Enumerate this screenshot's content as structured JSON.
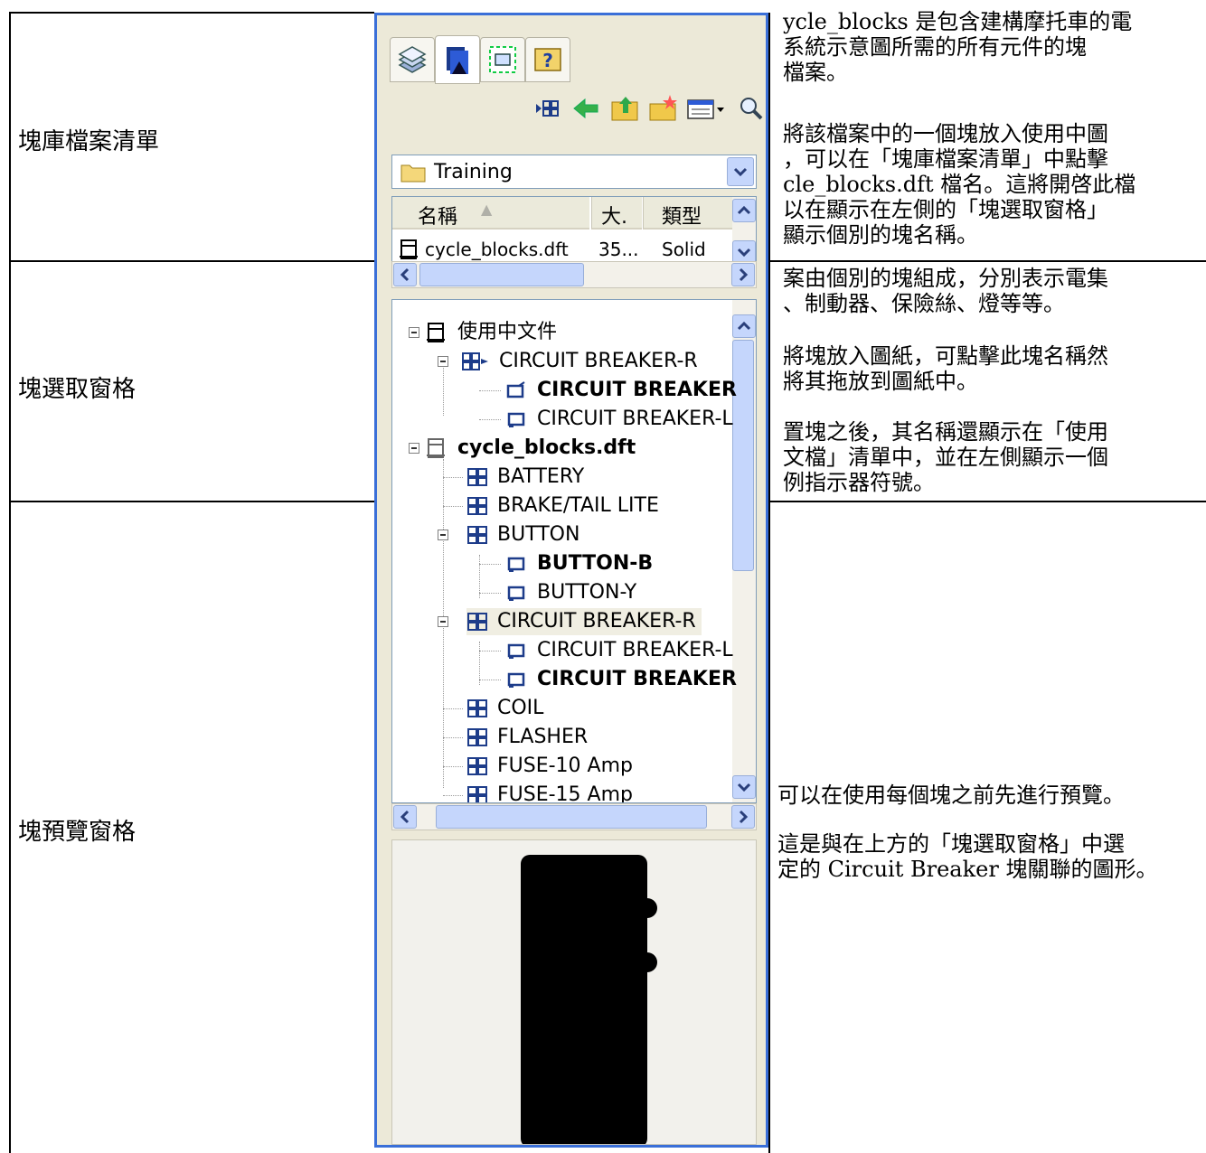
{
  "labels": {
    "library": "塊庫檔案清單",
    "selection": "塊選取窗格",
    "preview": "塊預覽窗格"
  },
  "panel": {
    "tabs": [
      "layers-icon",
      "library-icon",
      "blocks-icon",
      "help-icon"
    ],
    "toolbar": [
      "view-icon",
      "back-icon",
      "up-folder-icon",
      "new-folder-icon",
      "views-menu-icon",
      "search-icon"
    ],
    "folder": "Training",
    "list_headers": {
      "name": "名稱",
      "size": "大.",
      "type": "類型"
    },
    "file_row": {
      "name": "cycle_blocks.dft",
      "size": "35...",
      "type": "Solid Edge"
    },
    "tree": {
      "active_doc": "使用中文件",
      "active_block": "CIRCUIT BREAKER-R",
      "active_children": [
        "CIRCUIT BREAKER",
        "CIRCUIT BREAKER-L"
      ],
      "file": "cycle_blocks.dft",
      "items": [
        "BATTERY",
        "BRAKE/TAIL LITE",
        "BUTTON"
      ],
      "button_children": [
        "BUTTON-B",
        "BUTTON-Y"
      ],
      "cb": "CIRCUIT BREAKER-R",
      "cb_children": [
        "CIRCUIT BREAKER-L",
        "CIRCUIT BREAKER"
      ],
      "more": [
        "COIL",
        "FLASHER",
        "FUSE-10 Amp",
        "FUSE-15 Amp"
      ]
    }
  },
  "right": {
    "p1": [
      "ycle_blocks 是包含建構摩托車的電",
      "系統示意圖所需的所有元件的塊",
      "檔案。"
    ],
    "p2": [
      "將該檔案中的一個塊放入使用中圖",
      "，可以在「塊庫檔案清單」中點擊",
      "cle_blocks.dft 檔名。這將開啓此檔",
      "以在顯示在左側的「塊選取窗格」",
      "顯示個別的塊名稱。"
    ],
    "p3": [
      "案由個別的塊組成，分別表示電集",
      "、制動器、保險絲、燈等等。"
    ],
    "p4": [
      "將塊放入圖紙，可點擊此塊名稱然",
      "將其拖放到圖紙中。"
    ],
    "p5": [
      "置塊之後，其名稱還顯示在「使用",
      "文檔」清單中，並在左側顯示一個",
      "例指示器符號。"
    ],
    "p6": [
      "可以在使用每個塊之前先進行預覽。"
    ],
    "p7": [
      "這是與在上方的「塊選取窗格」中選",
      "定的 Circuit Breaker 塊關聯的圖形。"
    ]
  }
}
